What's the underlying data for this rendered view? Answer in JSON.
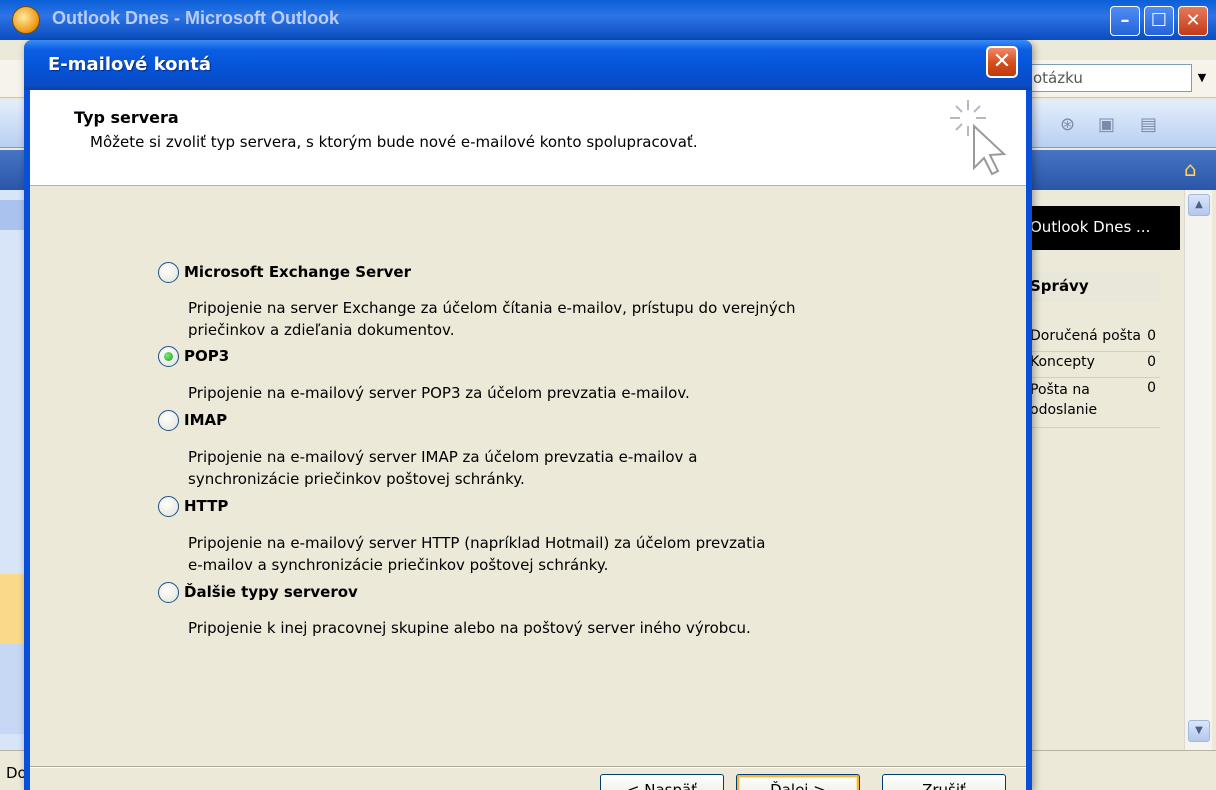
{
  "main_window": {
    "title": "Outlook Dnes - Microsoft Outlook",
    "ask_placeholder": "otázku",
    "outlook_today_label": "Outlook Dnes ...",
    "messages_heading": "Správy",
    "folders": [
      {
        "label": "Doručená pošta",
        "count": "0"
      },
      {
        "label": "Koncepty",
        "count": "0"
      },
      {
        "label": "Pošta na odoslanie",
        "count": "0"
      }
    ],
    "status_text": "Do"
  },
  "dialog": {
    "title": "E-mailové kontá",
    "close_symbol": "✕",
    "header_title": "Typ servera",
    "header_subtitle": "Môžete si zvoliť typ servera, s ktorým bude nové e-mailové konto spolupracovať.",
    "options": [
      {
        "label": "Microsoft Exchange Server",
        "checked": false,
        "desc1": "Pripojenie na server Exchange za účelom čítania e-mailov, prístupu do verejných",
        "desc2": "priečinkov a zdieľania dokumentov."
      },
      {
        "label": "POP3",
        "checked": true,
        "desc1": "Pripojenie na e-mailový server POP3 za účelom prevzatia e-mailov.",
        "desc2": ""
      },
      {
        "label": "IMAP",
        "checked": false,
        "desc1": "Pripojenie na e-mailový server IMAP za účelom prevzatia e-mailov a",
        "desc2": "synchronizácie priečinkov poštovej schránky."
      },
      {
        "label": "HTTP",
        "checked": false,
        "desc1": "Pripojenie na e-mailový server HTTP (napríklad Hotmail) za účelom prevzatia",
        "desc2": "e-mailov a synchronizácie priečinkov poštovej schránky."
      },
      {
        "label": "Ďalšie typy serverov",
        "checked": false,
        "desc1": "Pripojenie k inej pracovnej skupine alebo na poštový server iného výrobcu.",
        "desc2": ""
      }
    ],
    "buttons": {
      "back": "< Naspäť",
      "next": "Ďalej >",
      "cancel": "Zrušiť"
    }
  },
  "colors": {
    "titlebar_blue": "#0553d6",
    "dialog_face": "#ece9d8",
    "close_red": "#d5501f"
  }
}
